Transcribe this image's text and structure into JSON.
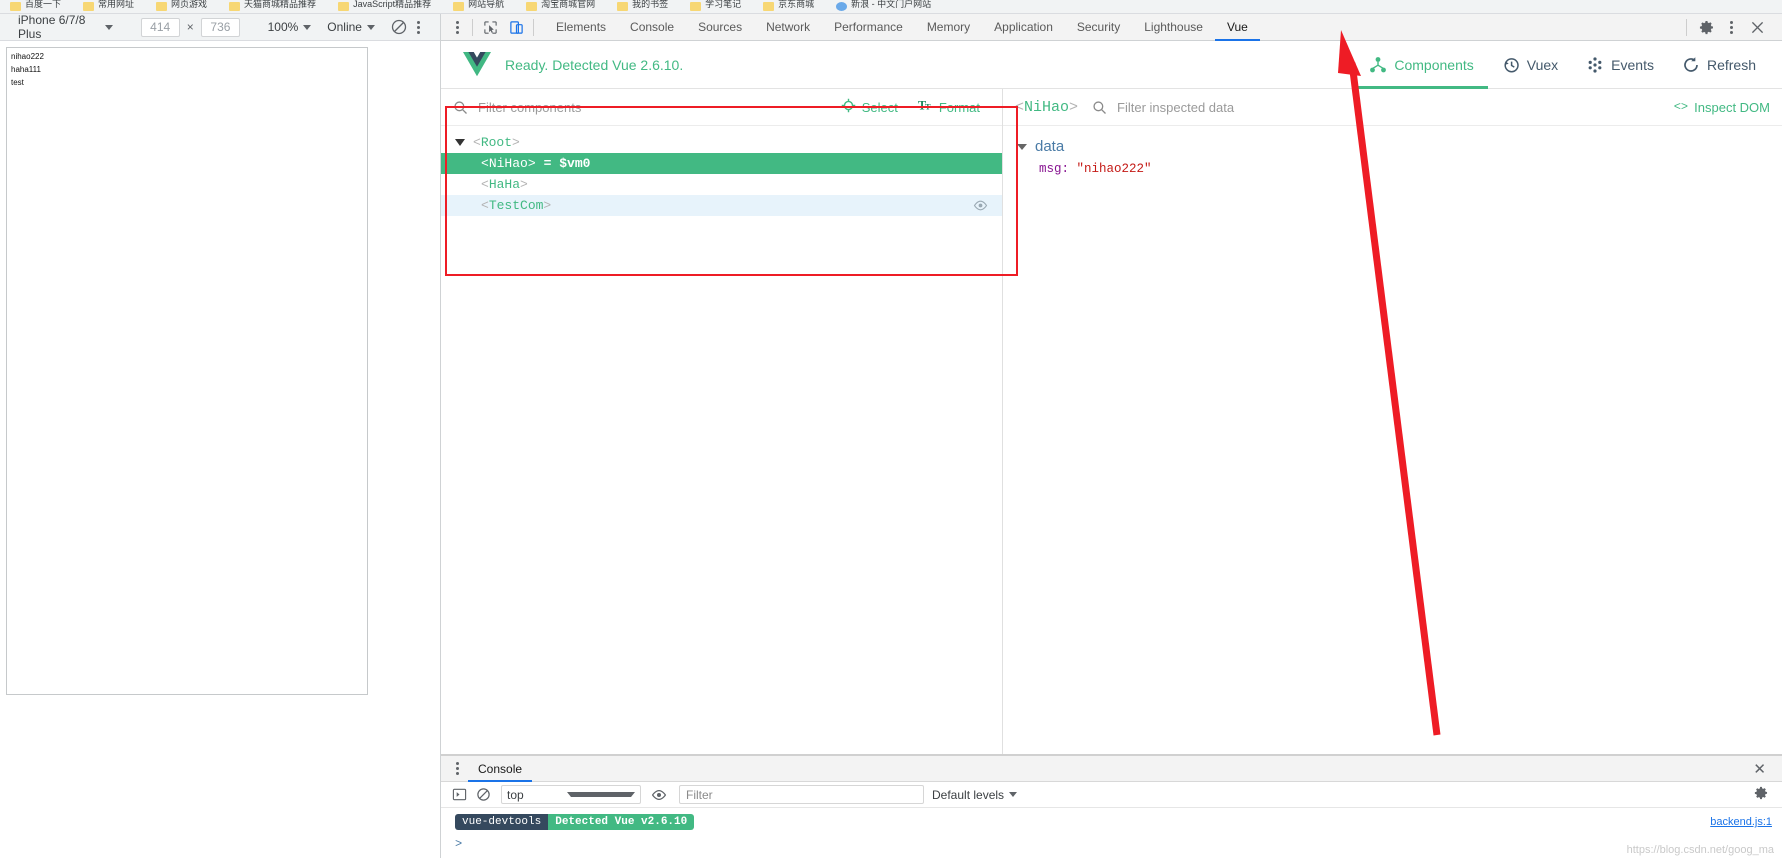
{
  "bookmarks": [
    {
      "label": "百度一下",
      "icon": "folder-icon"
    },
    {
      "label": "常用网址",
      "icon": "folder-icon"
    },
    {
      "label": "网页游戏",
      "icon": "folder-icon"
    },
    {
      "label": "天猫商城精品推荐",
      "icon": "folder-icon"
    },
    {
      "label": "JavaScript精品推荐",
      "icon": "folder-icon"
    },
    {
      "label": "网站导航",
      "icon": "folder-icon"
    },
    {
      "label": "淘宝商城官网",
      "icon": "folder-icon"
    },
    {
      "label": "我的书签",
      "icon": "folder-icon"
    },
    {
      "label": "学习笔记",
      "icon": "folder-icon"
    },
    {
      "label": "京东商城",
      "icon": "folder-icon"
    },
    {
      "label": "新浪 - 中文门户网站",
      "icon": "chrome-icon"
    }
  ],
  "device_toolbar": {
    "device": "iPhone 6/7/8 Plus",
    "width": "414",
    "height": "736",
    "zoom": "100%",
    "throttling": "Online",
    "rotate_icon": "rotate-icon",
    "more_icon": "kebab-menu-icon"
  },
  "viewport": {
    "lines": [
      "nihao222",
      "haha111",
      "test"
    ]
  },
  "devtools_toolbar": {
    "more_icon": "kebab-menu-icon",
    "inspect_icon": "inspect-element-icon",
    "device_icon": "toggle-device-toolbar-icon",
    "tabs": [
      {
        "label": "Elements",
        "active": false
      },
      {
        "label": "Console",
        "active": false
      },
      {
        "label": "Sources",
        "active": false
      },
      {
        "label": "Network",
        "active": false
      },
      {
        "label": "Performance",
        "active": false
      },
      {
        "label": "Memory",
        "active": false
      },
      {
        "label": "Application",
        "active": false
      },
      {
        "label": "Security",
        "active": false
      },
      {
        "label": "Lighthouse",
        "active": false
      },
      {
        "label": "Vue",
        "active": true
      }
    ],
    "settings_icon": "gear-icon",
    "menu_icon": "kebab-menu-icon",
    "close_icon": "close-icon"
  },
  "vue_header": {
    "logo": "vue-logo-icon",
    "status": "Ready. Detected Vue 2.6.10.",
    "status_color": "#42b983",
    "buttons": [
      {
        "label": "Components",
        "icon": "component-tree-icon",
        "active": true
      },
      {
        "label": "Vuex",
        "icon": "history-clock-icon",
        "active": false
      },
      {
        "label": "Events",
        "icon": "events-dots-icon",
        "active": false
      },
      {
        "label": "Refresh",
        "icon": "refresh-icon",
        "active": false
      }
    ]
  },
  "tree_panel": {
    "search": {
      "placeholder": "Filter components",
      "value": "",
      "icon": "search-icon"
    },
    "select_button": {
      "label": "Select",
      "icon": "crosshair-icon"
    },
    "format_button": {
      "label": "Format",
      "icon": "text-format-icon"
    },
    "nodes": [
      {
        "name": "Root",
        "depth": 0,
        "expanded": true,
        "state": "normal",
        "suffix": ""
      },
      {
        "name": "NiHao",
        "depth": 1,
        "expanded": false,
        "state": "selected",
        "suffix": "= $vm0"
      },
      {
        "name": "HaHa",
        "depth": 1,
        "expanded": false,
        "state": "normal",
        "suffix": ""
      },
      {
        "name": "TestCom",
        "depth": 1,
        "expanded": false,
        "state": "hovered",
        "suffix": "",
        "eye_icon": "eye-icon"
      }
    ]
  },
  "inspector_panel": {
    "component_name": "NiHao",
    "search": {
      "placeholder": "Filter inspected data",
      "value": "",
      "icon": "search-icon"
    },
    "inspect_dom": {
      "label": "Inspect DOM",
      "icon": "code-brackets-icon"
    },
    "groups": [
      {
        "name": "data",
        "expanded": true,
        "entries": [
          {
            "key": "msg",
            "value": "\"nihao222\""
          }
        ]
      }
    ]
  },
  "console_panel": {
    "more_icon": "kebab-menu-icon",
    "tab_label": "Console",
    "close_icon": "close-icon",
    "execute_icon": "execution-context-icon",
    "clear_icon": "clear-console-icon",
    "context": "top",
    "eye_icon": "live-expression-icon",
    "filter": {
      "placeholder": "Filter",
      "value": ""
    },
    "levels": "Default levels",
    "settings_icon": "gear-icon",
    "messages": [
      {
        "badge_left": "vue-devtools",
        "badge_right": "Detected Vue v2.6.10",
        "source": "backend.js:1"
      }
    ],
    "prompt": ">",
    "watermark": "https://blog.csdn.net/goog_ma"
  },
  "colors": {
    "vue_green": "#42b983",
    "annotation_red": "#ee1c25",
    "chrome_blue": "#1a73e8"
  }
}
